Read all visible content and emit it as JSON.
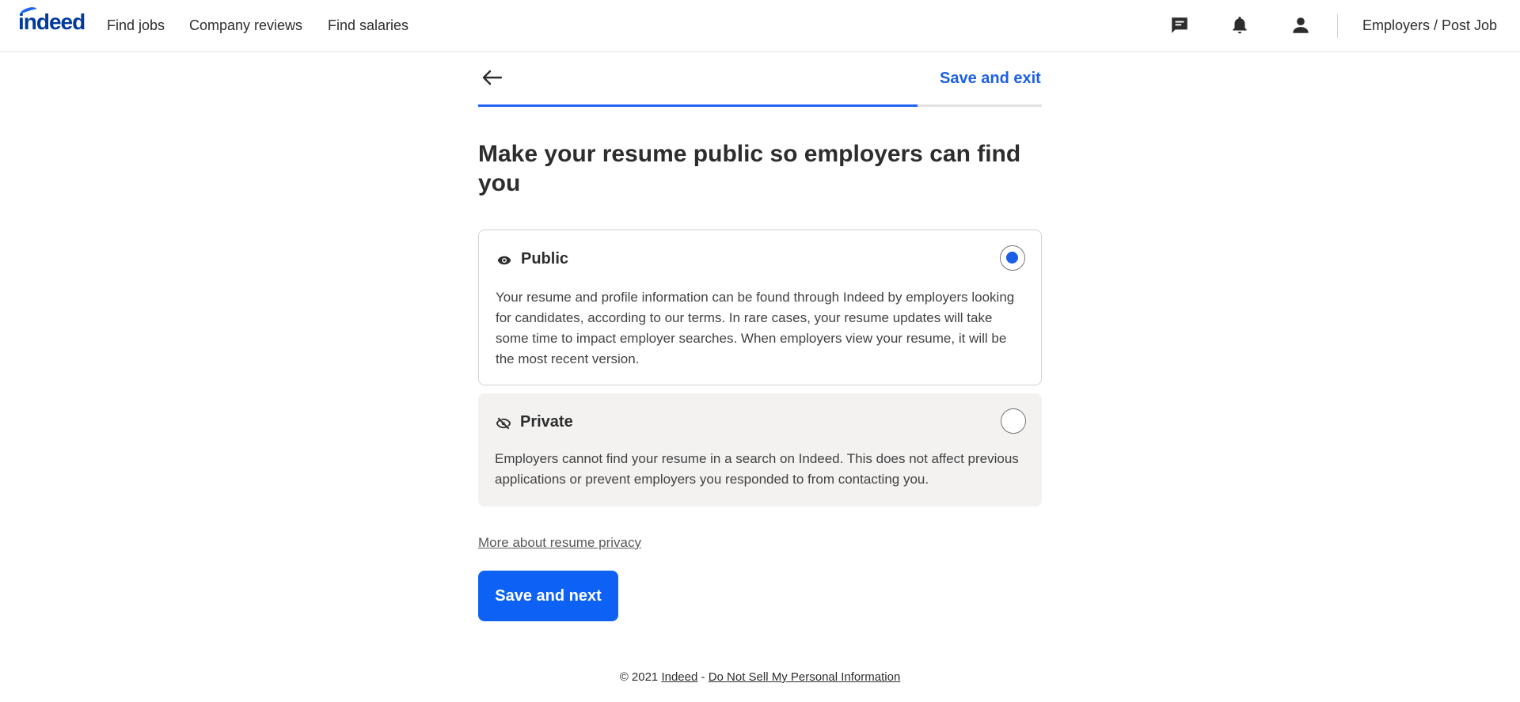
{
  "header": {
    "logo": "indeed",
    "nav": {
      "find_jobs": "Find jobs",
      "company_reviews": "Company reviews",
      "find_salaries": "Find salaries",
      "employers": "Employers / Post Job"
    },
    "icons": [
      "messages-icon",
      "notifications-icon",
      "account-icon"
    ]
  },
  "progress": {
    "save_exit_label": "Save and exit",
    "percent": 78
  },
  "main": {
    "title": "Make your resume public so employers can find you",
    "options": [
      {
        "label": "Public",
        "icon": "eye-icon",
        "selected": true,
        "description": "Your resume and profile information can be found through Indeed by employers looking for candidates, according to our terms. In rare cases, your resume updates will take some time to impact employer searches. When employers view your resume, it will be the most recent version."
      },
      {
        "label": "Private",
        "icon": "eye-off-icon",
        "selected": false,
        "description": "Employers cannot find your resume in a search on Indeed. This does not affect previous applications or prevent employers you responded to from contacting you."
      }
    ],
    "more_link": "More about resume privacy",
    "save_next_label": "Save and next"
  },
  "footer": {
    "copyright": "© 2021",
    "indeed_link": "Indeed",
    "separator": " - ",
    "privacy_link": "Do Not Sell My Personal Information"
  },
  "colors": {
    "accent": "#2164f3",
    "button": "#0d62f5",
    "brand": "#003a9b",
    "private_bg": "#f3f2f1"
  }
}
